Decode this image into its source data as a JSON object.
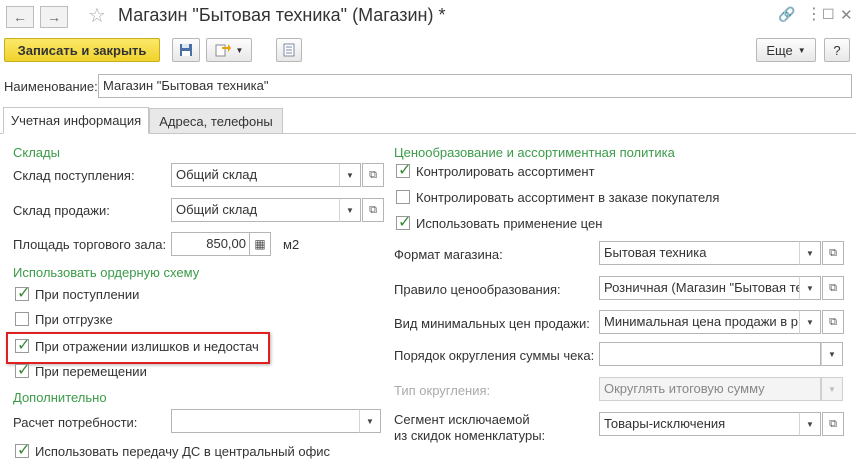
{
  "window": {
    "title": "Магазин \"Бытовая техника\" (Магазин) *"
  },
  "toolbar": {
    "save_close_label": "Записать и закрыть",
    "more_label": "Еще",
    "help_label": "?"
  },
  "name_field": {
    "label": "Наименование:",
    "value": "Магазин \"Бытовая техника\""
  },
  "tabs": [
    {
      "label": "Учетная информация",
      "active": true
    },
    {
      "label": "Адреса, телефоны",
      "active": false
    }
  ],
  "left": {
    "warehouses_group": "Склады",
    "receipt_wh": {
      "label": "Склад поступления:",
      "value": "Общий склад"
    },
    "sales_wh": {
      "label": "Склад продажи:",
      "value": "Общий склад"
    },
    "area": {
      "label": "Площадь торгового зала:",
      "value": "850,00",
      "unit": "м2"
    },
    "order_scheme_group": "Использовать ордерную схему",
    "order_checks": [
      {
        "label": "При поступлении",
        "checked": true
      },
      {
        "label": "При отгрузке",
        "checked": false
      },
      {
        "label": "При отражении излишков и недостач",
        "checked": true
      },
      {
        "label": "При перемещении",
        "checked": true
      }
    ],
    "extra_group": "Дополнительно",
    "needs_calc": {
      "label": "Расчет потребности:",
      "value": ""
    },
    "transfer_ds": {
      "label": "Использовать передачу ДС в центральный офис",
      "checked": true
    }
  },
  "right": {
    "pricing_group": "Ценообразование и ассортиментная политика",
    "checks": [
      {
        "label": "Контролировать ассортимент",
        "checked": true
      },
      {
        "label": "Контролировать ассортимент в заказе покупателя",
        "checked": false
      },
      {
        "label": "Использовать применение цен",
        "checked": true
      }
    ],
    "format": {
      "label": "Формат магазина:",
      "value": "Бытовая техника"
    },
    "price_rule": {
      "label": "Правило ценообразования:",
      "value": "Розничная (Магазин \"Бытовая те"
    },
    "min_price": {
      "label": "Вид минимальных цен продажи:",
      "value": "Минимальная цена продажи в р"
    },
    "rounding_order": {
      "label": "Порядок округления суммы чека:",
      "value": ""
    },
    "rounding_type": {
      "label": "Тип округления:",
      "value": "Округлять итоговую сумму"
    },
    "segment": {
      "label1": "Сегмент исключаемой",
      "label2": "из скидок номенклатуры:",
      "value": "Товары-исключения"
    }
  },
  "colors": {
    "accent_green": "#3a9b48",
    "primary_button": "#f0d32c",
    "highlight_border": "#e02020"
  }
}
